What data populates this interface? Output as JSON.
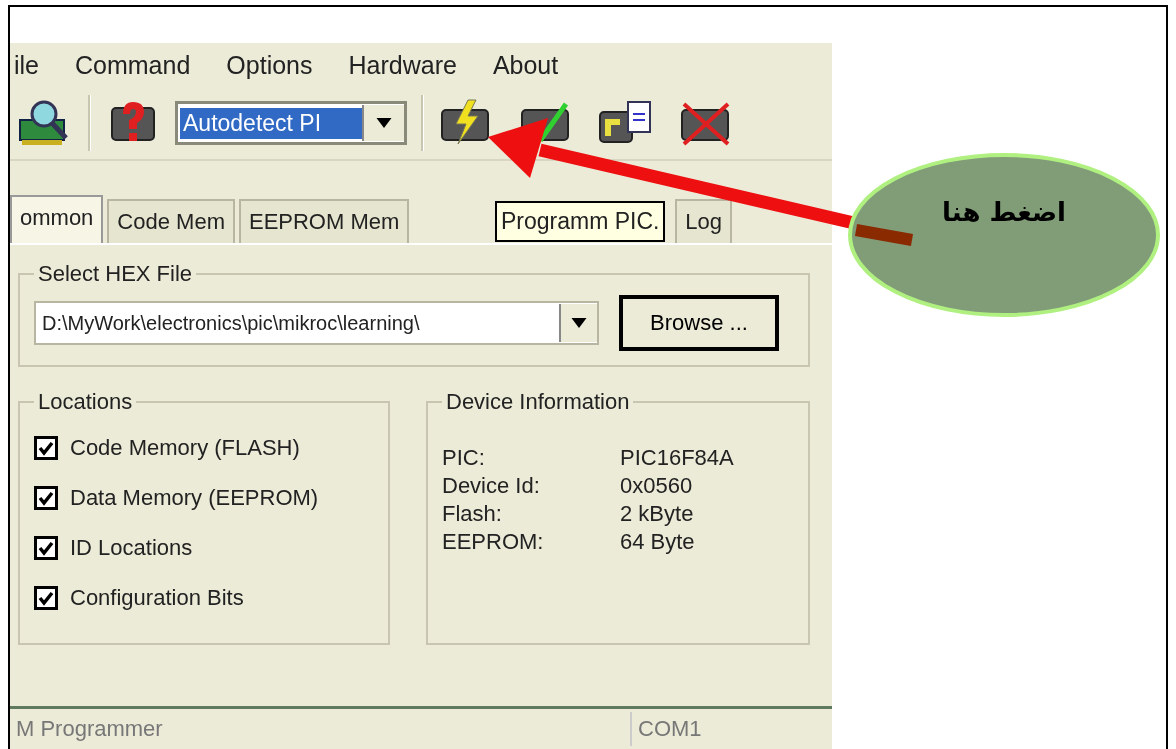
{
  "menu": [
    {
      "label": "ile"
    },
    {
      "label": "Command"
    },
    {
      "label": "Options"
    },
    {
      "label": "Hardware"
    },
    {
      "label": "About"
    }
  ],
  "toolbar": {
    "device_combo": {
      "value": "Autodetect PI"
    }
  },
  "tabs": [
    {
      "label": "ommon",
      "selected": true
    },
    {
      "label": "Code Mem",
      "selected": false
    },
    {
      "label": "EEPROM Mem",
      "selected": false
    },
    {
      "label": "Log",
      "selected": false
    }
  ],
  "tooltip": "Programm PIC.",
  "hex_file": {
    "title": "Select HEX File",
    "path": "D:\\MyWork\\electronics\\pic\\mikroc\\learning\\",
    "browse": "Browse ..."
  },
  "locations": {
    "title": "Locations",
    "items": [
      {
        "label": "Code Memory (FLASH)",
        "checked": true
      },
      {
        "label": "Data Memory (EEPROM)",
        "checked": true
      },
      {
        "label": "ID Locations",
        "checked": true
      },
      {
        "label": "Configuration Bits",
        "checked": true
      }
    ]
  },
  "device_info": {
    "title": "Device Information",
    "rows": [
      {
        "label": "PIC:",
        "value": "PIC16F84A"
      },
      {
        "label": "Device Id:",
        "value": "0x0560"
      },
      {
        "label": "Flash:",
        "value": "2 kByte"
      },
      {
        "label": "EEPROM:",
        "value": "64 Byte"
      }
    ]
  },
  "status_bar": [
    "M Programmer",
    "COM1"
  ],
  "callout": {
    "text": "اضغط هنا"
  }
}
